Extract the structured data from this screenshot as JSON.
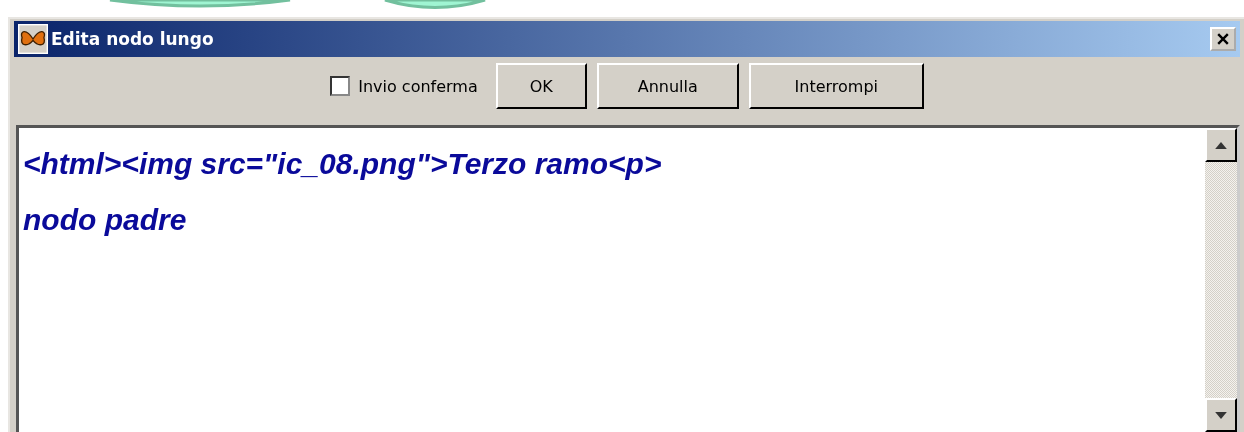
{
  "window": {
    "title": "Edita nodo lungo"
  },
  "toolbar": {
    "checkbox": {
      "label": "Invio conferma",
      "checked": false
    },
    "buttons": [
      "OK",
      "Annulla",
      "Interrompi"
    ]
  },
  "editor": {
    "lines": [
      "<html><img src=\"ic_08.png\">Terzo ramo<p>",
      "nodo padre"
    ]
  }
}
